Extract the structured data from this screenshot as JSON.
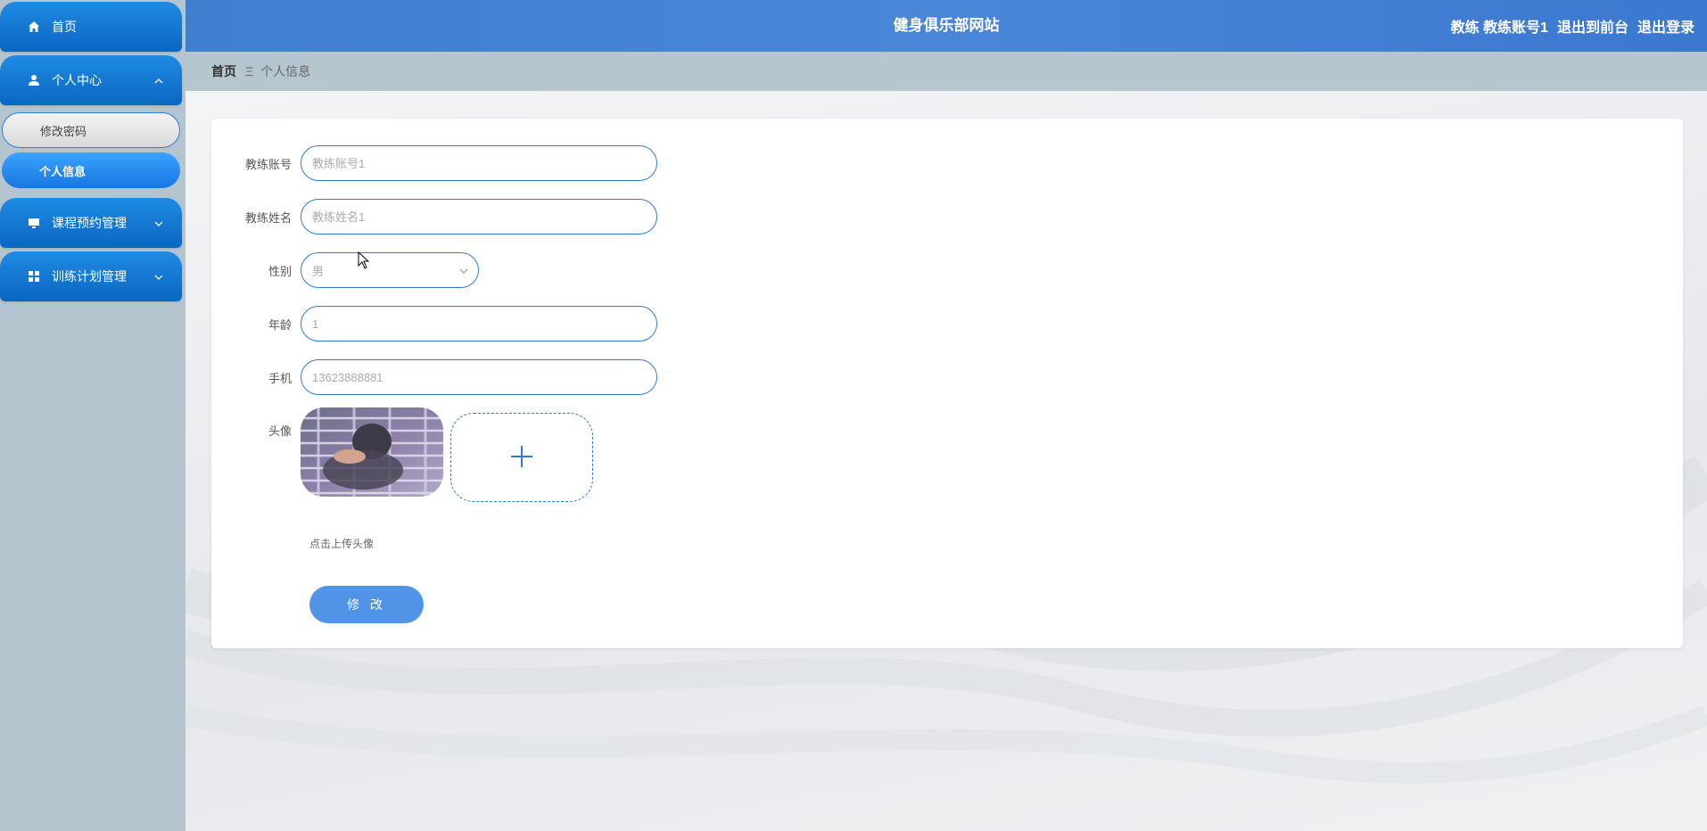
{
  "sidebar": {
    "items": [
      {
        "label": "首页",
        "icon": "home-icon"
      },
      {
        "label": "个人中心",
        "icon": "user-icon",
        "expanded": true,
        "children": [
          {
            "label": "修改密码",
            "active": false
          },
          {
            "label": "个人信息",
            "active": true
          }
        ]
      },
      {
        "label": "课程预约管理",
        "icon": "monitor-icon"
      },
      {
        "label": "训练计划管理",
        "icon": "grid-icon"
      }
    ]
  },
  "header": {
    "title": "健身俱乐部网站",
    "user": "教练 教练账号1",
    "to_front": "退出到前台",
    "logout": "退出登录"
  },
  "breadcrumb": {
    "home": "首页",
    "separator": "Ξ",
    "current": "个人信息"
  },
  "form": {
    "account": {
      "label": "教练账号",
      "placeholder": "教练账号1"
    },
    "name": {
      "label": "教练姓名",
      "placeholder": "教练姓名1"
    },
    "gender": {
      "label": "性别",
      "value": "男"
    },
    "age": {
      "label": "年龄",
      "placeholder": "1"
    },
    "phone": {
      "label": "手机",
      "placeholder": "13623888881"
    },
    "avatar": {
      "label": "头像",
      "tip": "点击上传头像"
    },
    "submit_label": "修 改"
  },
  "colors": {
    "primary": "#2d7bd8",
    "header": "#4a86d8",
    "sidebar_bg": "#b4c5d0",
    "button": "#5094e8"
  }
}
